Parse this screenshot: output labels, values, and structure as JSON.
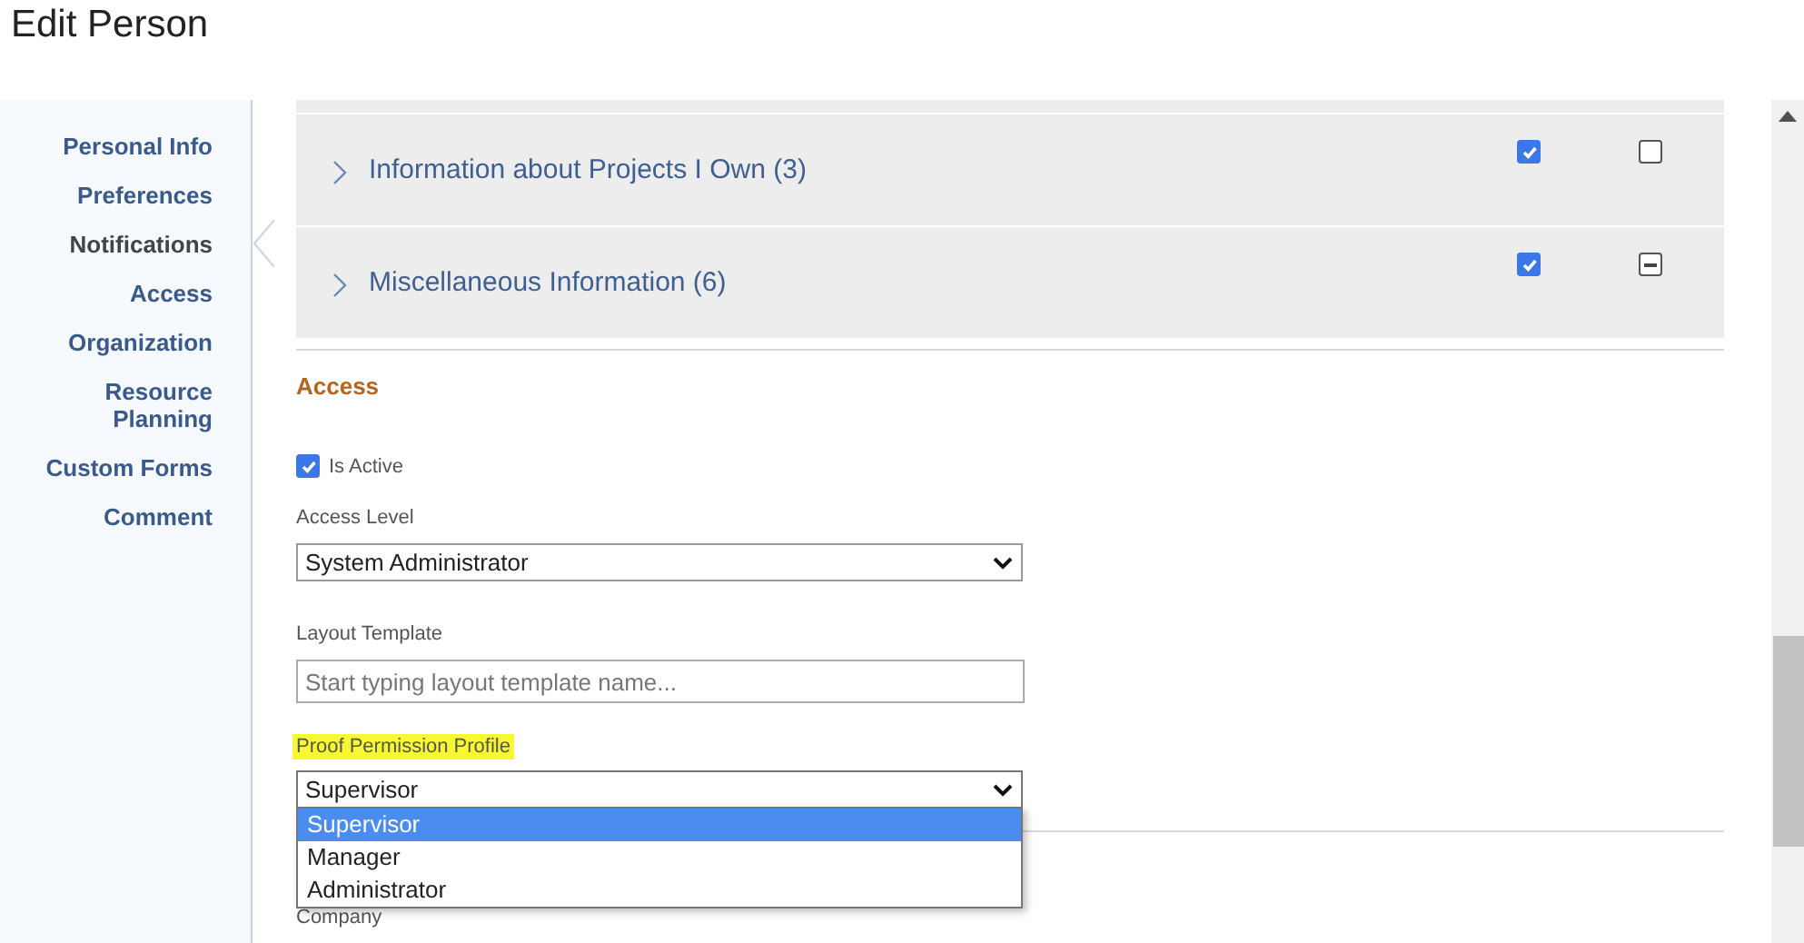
{
  "page": {
    "title": "Edit Person"
  },
  "sidebar": {
    "items": [
      {
        "label": "Personal Info",
        "selected": false
      },
      {
        "label": "Preferences",
        "selected": false
      },
      {
        "label": "Notifications",
        "selected": true
      },
      {
        "label": "Access",
        "selected": false
      },
      {
        "label": "Organization",
        "selected": false
      },
      {
        "label": "Resource Planning",
        "selected": false
      },
      {
        "label": "Custom Forms",
        "selected": false
      },
      {
        "label": "Comment",
        "selected": false
      }
    ]
  },
  "notification_groups": [
    {
      "label": "Information about Projects I Own (3)",
      "expanded": false,
      "column_1": {
        "checked": true
      },
      "column_2": {
        "checked": false
      }
    },
    {
      "label": "Miscellaneous Information (6)",
      "expanded": false,
      "column_1": {
        "checked": true
      },
      "column_2": {
        "mixed": true
      }
    }
  ],
  "access": {
    "heading": "Access",
    "is_active": {
      "label": "Is Active",
      "checked": true
    },
    "access_level": {
      "label": "Access Level",
      "value": "System Administrator"
    },
    "layout_template": {
      "label": "Layout Template",
      "placeholder": "Start typing layout template name..."
    },
    "proof_permission_profile": {
      "label": "Proof Permission Profile",
      "highlighted": true,
      "value": "Supervisor",
      "expanded": true,
      "options": [
        {
          "label": "Supervisor",
          "selected": true
        },
        {
          "label": "Manager",
          "selected": false
        },
        {
          "label": "Administrator",
          "selected": false
        }
      ]
    },
    "company": {
      "label": "Company"
    }
  }
}
